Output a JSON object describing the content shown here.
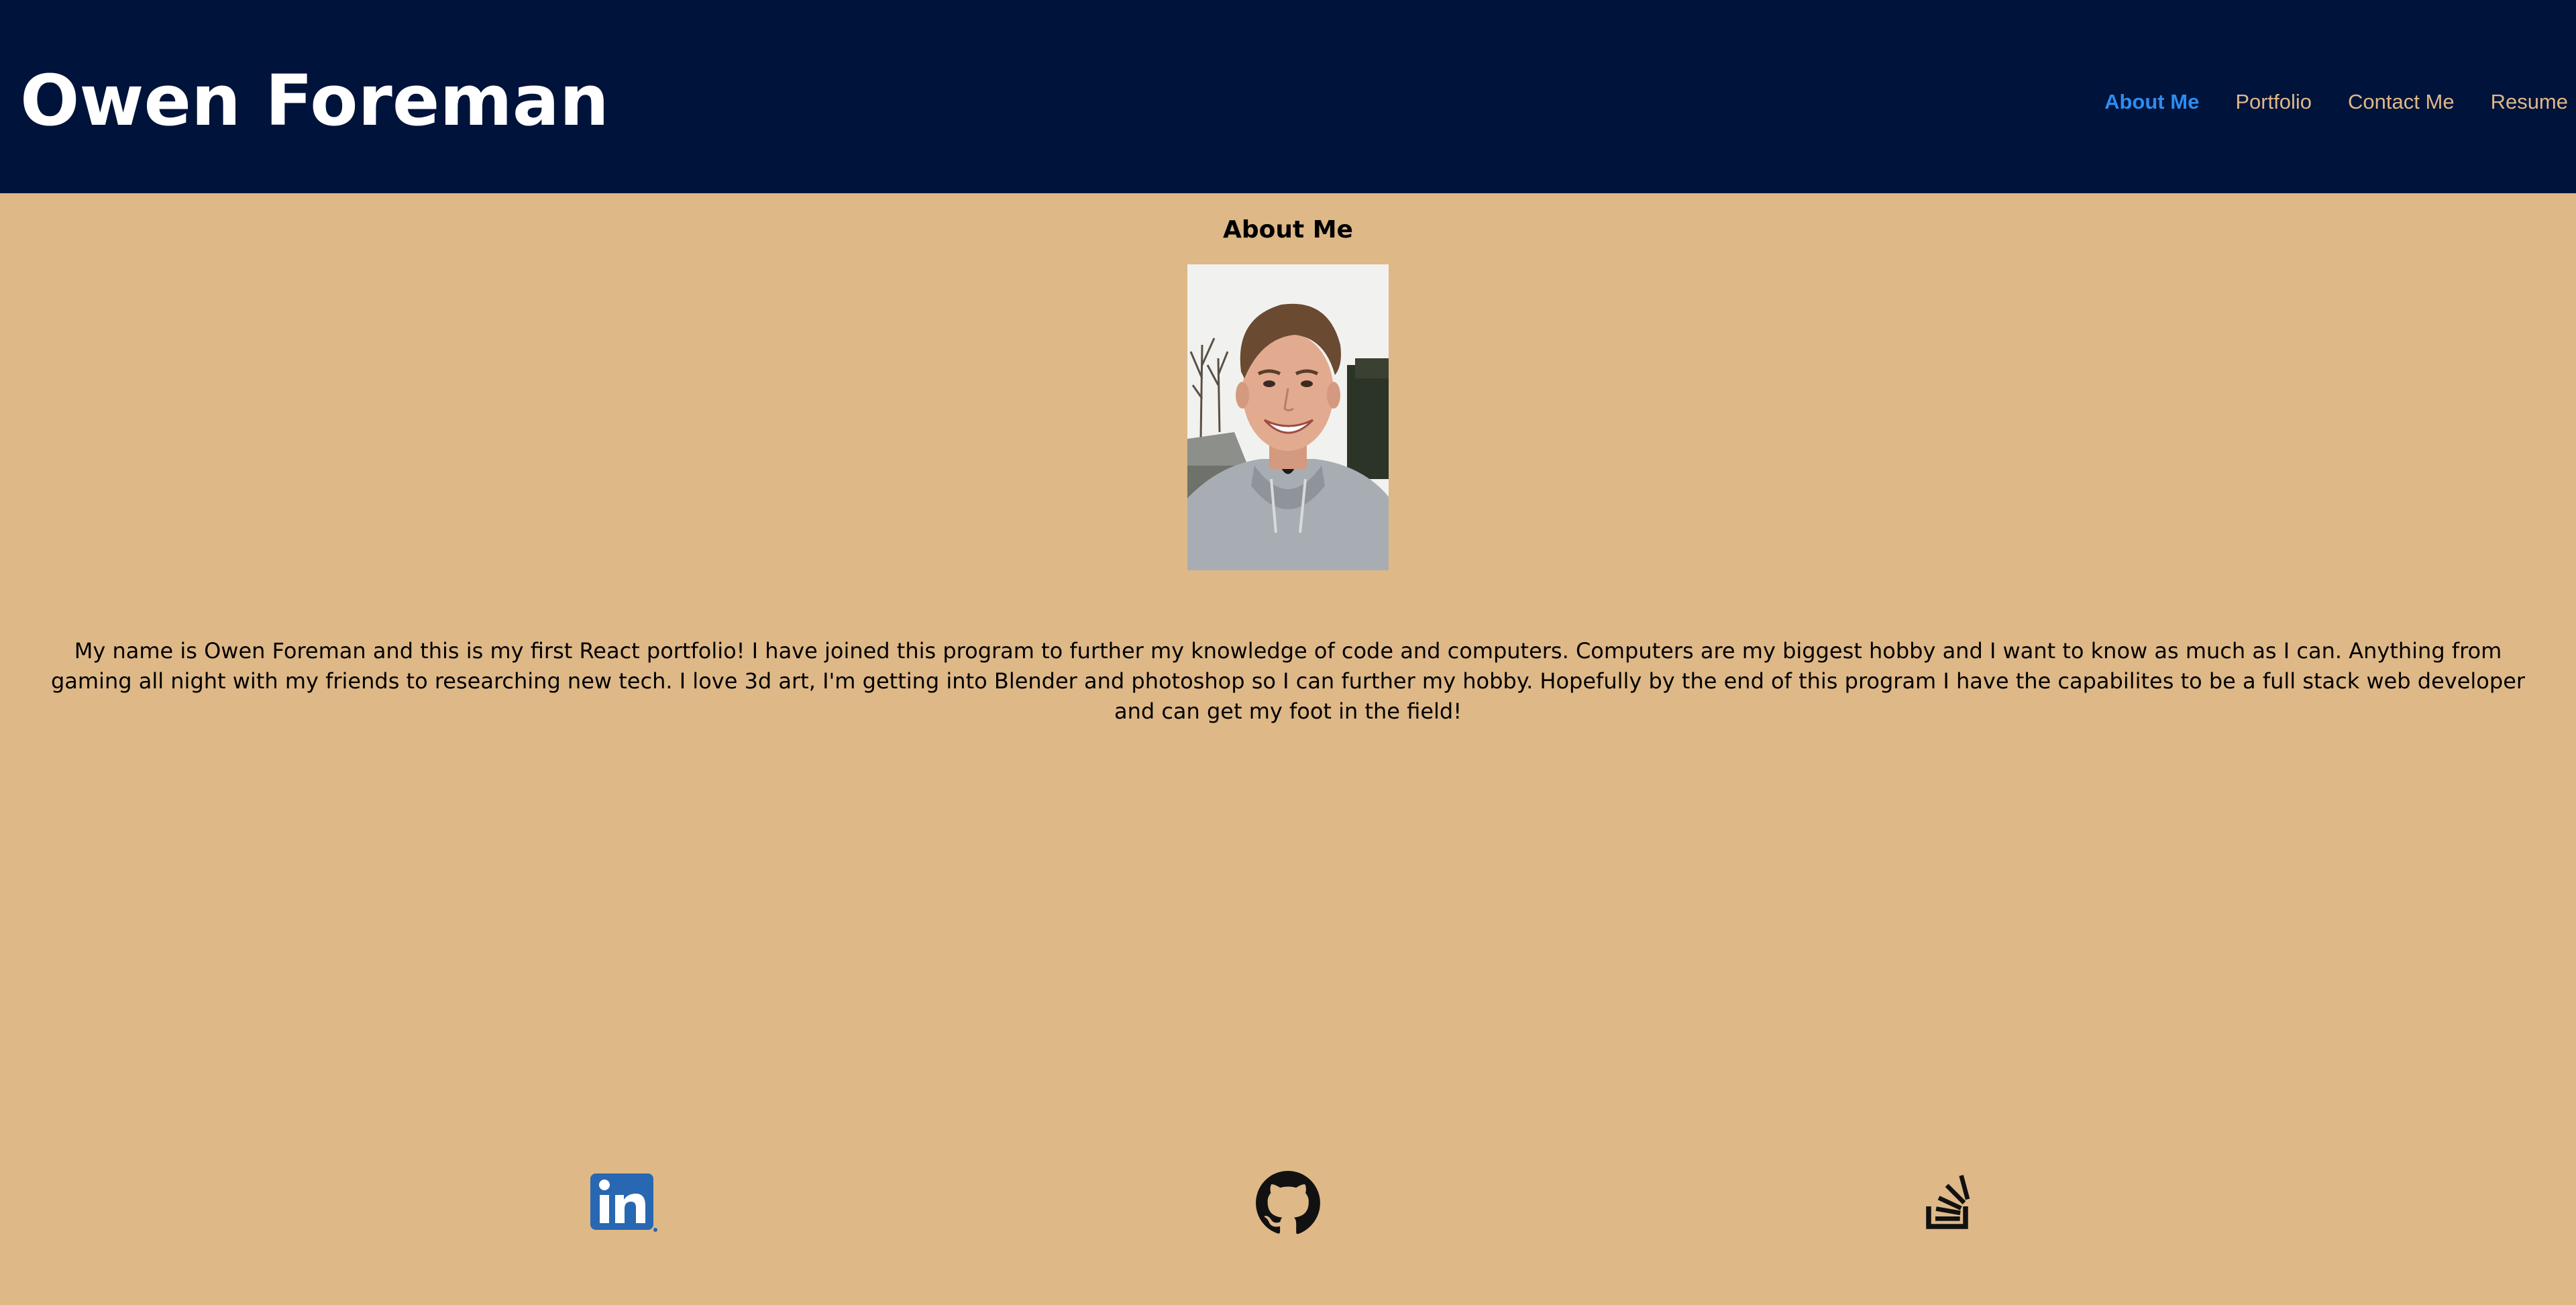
{
  "header": {
    "title": "Owen Foreman",
    "nav": [
      {
        "label": "About Me",
        "active": true
      },
      {
        "label": "Portfolio",
        "active": false
      },
      {
        "label": "Contact Me",
        "active": false
      },
      {
        "label": "Resume",
        "active": false
      }
    ]
  },
  "about": {
    "heading": "About Me",
    "photo_subject": "smiling young man in grey hoodie outdoors",
    "bio": "My name is Owen Foreman and this is my first React portfolio! I have joined this program to further my knowledge of code and computers. Computers are my biggest hobby and I want to know as much as I can. Anything from gaming all night with my friends to researching new tech. I love 3d art, I'm getting into Blender and photoshop so I can further my hobby. Hopefully by the end of this program I have the capabilites to be a full stack web developer and can get my foot in the field!"
  },
  "footer": {
    "links": [
      {
        "icon": "linkedin-icon",
        "color": "#2867b2"
      },
      {
        "icon": "github-icon",
        "color": "#111111"
      },
      {
        "icon": "stack-overflow-icon",
        "color": "#111111"
      }
    ]
  },
  "colors": {
    "header_bg": "#00133b",
    "page_bg": "#deb887",
    "nav_text": "#deb887",
    "nav_active": "#2d8cf0",
    "title_text": "#ffffff"
  }
}
